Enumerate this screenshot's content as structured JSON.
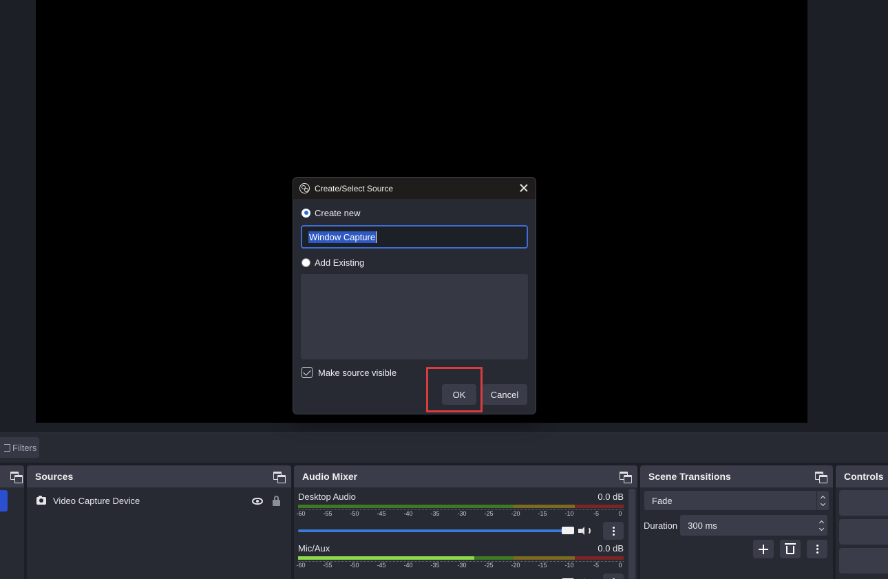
{
  "dialog": {
    "title": "Create/Select Source",
    "create_new_label": "Create new",
    "name_value": "Window Capture",
    "add_existing_label": "Add Existing",
    "make_visible_label": "Make source visible",
    "ok_label": "OK",
    "cancel_label": "Cancel"
  },
  "toolbar": {
    "filters_label": "Filters"
  },
  "sources": {
    "title": "Sources",
    "items": [
      {
        "name": "Video Capture Device"
      }
    ]
  },
  "mixer": {
    "title": "Audio Mixer",
    "channels": [
      {
        "name": "Desktop Audio",
        "level": "0.0 dB"
      },
      {
        "name": "Mic/Aux",
        "level": "0.0 dB"
      }
    ],
    "ticks": [
      "-60",
      "-55",
      "-50",
      "-45",
      "-40",
      "-35",
      "-30",
      "-25",
      "-20",
      "-15",
      "-10",
      "-5",
      "0"
    ]
  },
  "transitions": {
    "title": "Scene Transitions",
    "selected": "Fade",
    "duration_label": "Duration",
    "duration_value": "300 ms"
  },
  "controls": {
    "title": "Controls"
  },
  "colors": {
    "accent": "#2c4fd0",
    "highlight": "#d93d3d",
    "panel": "#272a33",
    "header": "#3a3d49"
  }
}
